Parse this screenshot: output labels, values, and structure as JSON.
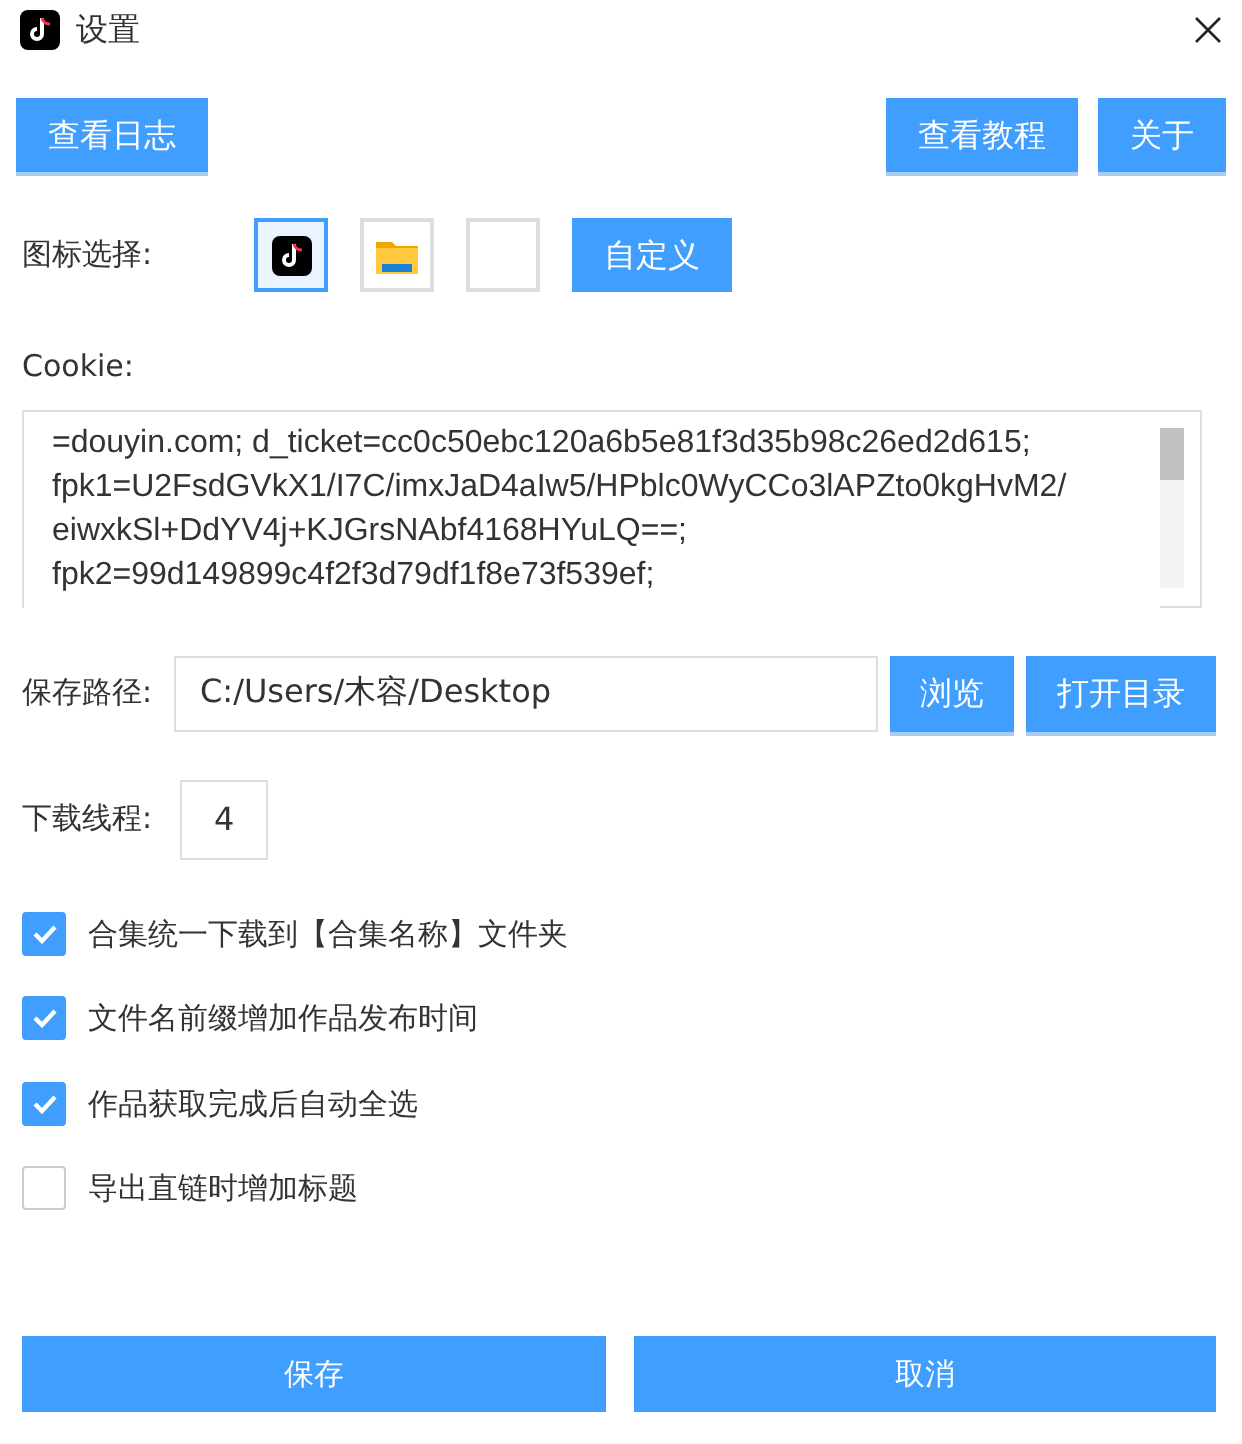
{
  "window": {
    "title": "设置"
  },
  "top_buttons": [
    "查看日志",
    "查看教程",
    "关于"
  ],
  "icon_choice": {
    "label": "图标选择:",
    "options": [
      {
        "kind": "tiktok",
        "selected": true
      },
      {
        "kind": "folder",
        "selected": false
      },
      {
        "kind": "blank",
        "selected": false
      }
    ],
    "custom_button": "自定义"
  },
  "cookie": {
    "label": "Cookie:",
    "lines": [
      "=douyin.com; d_ticket=cc0c50ebc120a6b5e81f3d35b98c26ed2d615;",
      "fpk1=U2FsdGVkX1/I7C/imxJaD4aIw5/HPblc0WyCCo3lAPZto0kgHvM2/",
      "eiwxkSl+DdYV4j+KJGrsNAbf4168HYuLQ==;",
      "fpk2=99d149899c4f2f3d79df1f8e73f539ef;"
    ]
  },
  "save_path": {
    "label": "保存路径:",
    "value": "C:/Users/木容/Desktop",
    "buttons": [
      "浏览",
      "打开目录"
    ]
  },
  "threads": {
    "label": "下载线程:",
    "value": "4"
  },
  "options": [
    {
      "label": "合集统一下载到【合集名称】文件夹",
      "checked": true
    },
    {
      "label": "文件名前缀增加作品发布时间",
      "checked": true
    },
    {
      "label": "作品获取完成后自动全选",
      "checked": true
    },
    {
      "label": "导出直链时增加标题",
      "checked": false
    }
  ],
  "footer_buttons": [
    "保存",
    "取消"
  ]
}
